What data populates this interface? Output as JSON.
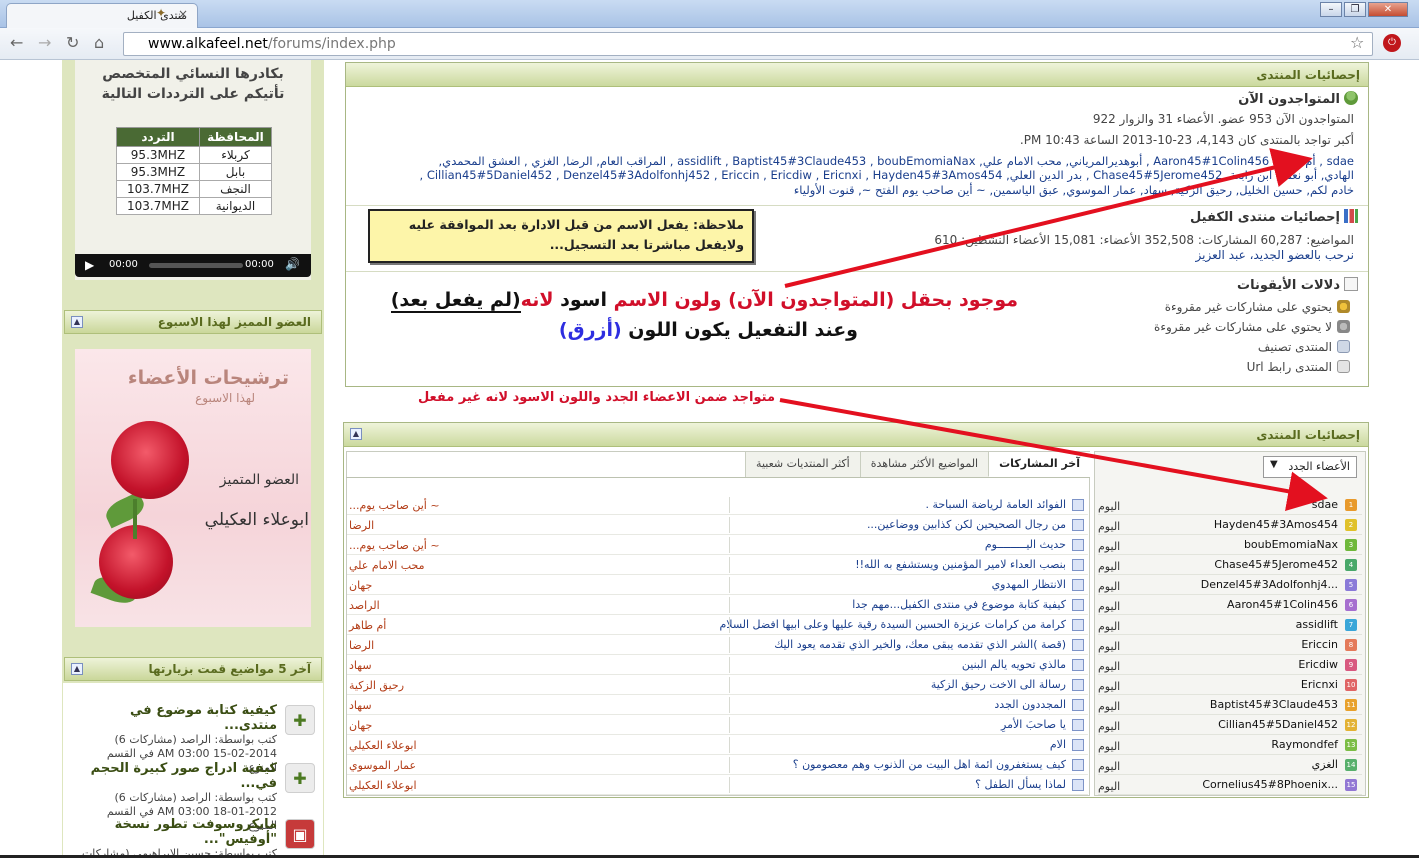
{
  "browser": {
    "tab_title": "منتدى الكفيل",
    "url_host": "www.alkafeel.net",
    "url_path": "/forums/index.php"
  },
  "sidebar": {
    "radio_lines": [
      "بكادرها النسائي المتخصص",
      "تأتيكم على الترددات التالية"
    ],
    "freq_headers": [
      "المحافظة",
      "التردد"
    ],
    "freq_rows": [
      [
        "كربلاء",
        "95.3MHZ"
      ],
      [
        "بابل",
        "95.3MHZ"
      ],
      [
        "النجف",
        "103.7MHZ"
      ],
      [
        "الديوانية",
        "103.7MHZ"
      ]
    ],
    "player_time_left": "00:00",
    "player_time_right": "00:00",
    "featured_title": "العضو المميز لهذا الاسبوع",
    "featured_img_title": "ترشيحات الأعضاء",
    "featured_img_sub": "لهذا الاسبوع",
    "featured_label": "العضو المتميز",
    "featured_name": "ابوعلاء العكيلي",
    "topics_title": "آخر 5 مواضيع قمت بزيارتها",
    "topics": [
      {
        "title": "كيفية كتابة موضوع في منتدى...",
        "by": "كتب بواسطة: الراصد (مشاركات 6)",
        "date": "15-02-2014 03:00 AM في القسم المنوع"
      },
      {
        "title": "كيفية ادراج صور كبيرة الحجم في...",
        "by": "كتب بواسطة: الراصد (مشاركات 6)",
        "date": "18-01-2012 03:00 AM في القسم المنوع"
      },
      {
        "title": "مايكروسوفت تطور نسخة \"أوفيس\"...",
        "by": "كتب بواسطة: حسين الابراهيمي (مشاركات",
        "date": ""
      }
    ]
  },
  "stats1": {
    "header": "إحصائيات المنتدى",
    "online_title": "المتواجدون الآن",
    "online_line": "المتواجدون الآن 953 عضو. الأعضاء 31 والزوار 922",
    "record_line": "أكبر تواجد بالمنتدى كان 4,143، 23-10-2013 الساعة 10:43 PM.",
    "users_line1": "sdae , أم طاهر, Aaron45#1Colin456 , أبوهديرالمرياني, محب الامام علي, assidlift , Baptist45#3Claude453 , boubEmomiaNax , المراقب العام, الرضا, الغزي , العشق المحمدي,",
    "users_line2": "الهادي, أبو نعمة, ابن رابعة, Chase45#5Jerome452 , بدر الدين العلي, Cillian45#5Daniel452 , Denzel45#3Adolfonhj452 , Ericcin , Ericdiw , Ericnxi , Hayden45#3Amos454 ,",
    "users_line3": "خادم لكم, حسين الخليل, رحيق الزكية, سهاد, عمار الموسوي, عبق الياسمين, ~ أين صاحب يوم الفتح ~, قنوت الأولياء",
    "kafeel_title": "إحصائيات منتدى الكفيل",
    "kafeel_counts": "المواضيع: 60,287   المشاركات: 352,508   الأعضاء: 15,081   الأعضاء النشطين: 610",
    "welcome": "نرحب بالعضو الجديد، عبد العزيز",
    "icons_title": "دلالات الأيقونات",
    "legend": [
      "يحتوي على مشاركات غير مقروءة",
      "لا يحتوي على مشاركات غير مقروءة",
      "المنتدى تصنيف",
      "المنتدى رابط Url"
    ]
  },
  "note": {
    "line1": "ملاحظة: يفعل الاسم من قبل الادارة بعد الموافقة عليه",
    "line2": "ولايفعل مباشرتا بعد التسجيل..."
  },
  "annot_big": {
    "p1": "موجود بحقل ",
    "p2": "(المتواجدون الآن)",
    "p3": " ولون الاسم ",
    "p4": "اسود",
    "p5": " لانه",
    "p6": "(لم يفعل بعد)",
    "p7": "وعند التفعيل يكون اللون ",
    "p8": "(أزرق)"
  },
  "annot_small": "متواجد ضمن الاعضاء الجدد واللون الاسود لانه غير مفعل",
  "stats2": {
    "header": "إحصائيات المنتدى",
    "select_value": "الأعضاء الجدد",
    "tabs": [
      "آخر المشاركات",
      "المواضيع الأكثر مشاهدة",
      "أكثر المنتديات شعبية"
    ],
    "members": [
      {
        "name": "sdae",
        "date": "اليوم",
        "badge": "1",
        "color": "#e89a2c"
      },
      {
        "name": "Hayden45#3Amos454",
        "date": "اليوم",
        "badge": "2",
        "color": "#e0c12a"
      },
      {
        "name": "boubEmomiaNax",
        "date": "اليوم",
        "badge": "3",
        "color": "#6fb83b"
      },
      {
        "name": "Chase45#5Jerome452",
        "date": "اليوم",
        "badge": "4",
        "color": "#49a86a"
      },
      {
        "name": "Denzel45#3Adolfonhj4...",
        "date": "اليوم",
        "badge": "5",
        "color": "#8a7ad8"
      },
      {
        "name": "Aaron45#1Colin456",
        "date": "اليوم",
        "badge": "6",
        "color": "#a66fcf"
      },
      {
        "name": "assidlift",
        "date": "اليوم",
        "badge": "7",
        "color": "#3aa6d8"
      },
      {
        "name": "Ericcin",
        "date": "اليوم",
        "badge": "8",
        "color": "#e47a5a"
      },
      {
        "name": "Ericdiw",
        "date": "اليوم",
        "badge": "9",
        "color": "#d8597f"
      },
      {
        "name": "Ericnxi",
        "date": "اليوم",
        "badge": "10",
        "color": "#e06565"
      },
      {
        "name": "Baptist45#3Claude453",
        "date": "اليوم",
        "badge": "11",
        "color": "#e8a12c"
      },
      {
        "name": "Cillian45#5Daniel452",
        "date": "اليوم",
        "badge": "12",
        "color": "#e3b234"
      },
      {
        "name": "Raymondfef",
        "date": "اليوم",
        "badge": "13",
        "color": "#7cbd45"
      },
      {
        "name": "الغزي",
        "date": "اليوم",
        "badge": "14",
        "color": "#58b06c"
      },
      {
        "name": "Cornelius45#8Phoenix...",
        "date": "اليوم",
        "badge": "15",
        "color": "#9277d4"
      }
    ],
    "posts": [
      {
        "title": "الفوائد العامة لرياضة السباحة .",
        "author": "~ أين صاحب يوم..."
      },
      {
        "title": "من رجال الصحيحين لكن كذابين ووضاعين...",
        "author": "الرضا"
      },
      {
        "title": "حديث اليـــــــــوم",
        "author": "~ أين صاحب يوم..."
      },
      {
        "title": "بنصب العداء لامير المؤمنين ويستشفع به الله!!",
        "author": "محب الامام علي"
      },
      {
        "title": "الانتظار المهدوي",
        "author": "جهان"
      },
      {
        "title": "كيفية كتابة موضوع في منتدى الكفيل...مهم جدا",
        "author": "الراصد"
      },
      {
        "title": "كرامة من كرامات عزيزة الحسين السيدة رقية عليها وعلى ابيها افضل السلام",
        "author": "أم طاهر"
      },
      {
        "title": "(قصة )الشر الذي تقدمه يبقى معك، والخير الذي تقدمه يعود اليك",
        "author": "الرضا"
      },
      {
        "title": "مالذي تحويه يالم البنين",
        "author": "سهاد"
      },
      {
        "title": "رسالة الى الاخت رحيق الزكية",
        "author": "رحيق الزكية"
      },
      {
        "title": "المجددون الجدد",
        "author": "سهاد"
      },
      {
        "title": "يا صاحبَ الأمرِ",
        "author": "جهان"
      },
      {
        "title": "الام",
        "author": "ابوعلاء العكيلي"
      },
      {
        "title": "كيف يستغفرون ائمة اهل البيت من الذنوب وهم معصومون ؟",
        "author": "عمار الموسوي"
      },
      {
        "title": "لماذا يسأل الطفل ؟",
        "author": "ابوعلاء العكيلي"
      }
    ]
  },
  "colors": {
    "header_green": "#5a6b1f",
    "annot_red": "#d10f2a",
    "annot_blue": "#2e2ee0",
    "note_bg": "#fdf5a9"
  }
}
